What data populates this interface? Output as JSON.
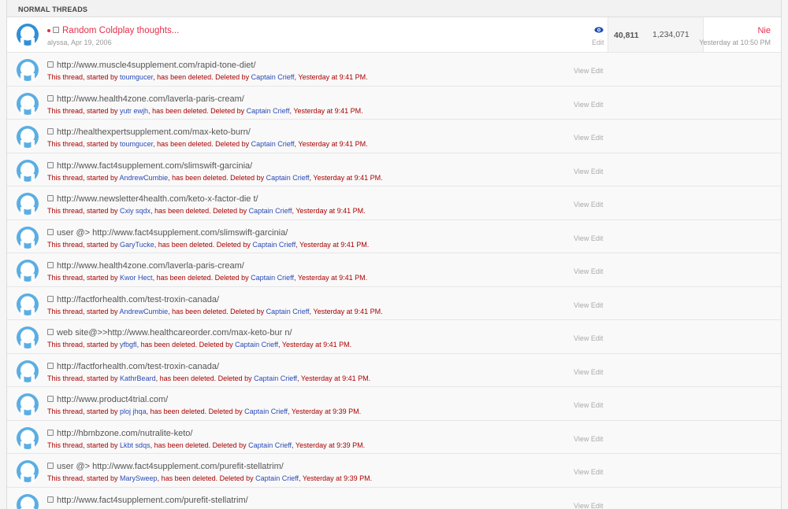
{
  "section": {
    "title": "NORMAL THREADS"
  },
  "sticky": {
    "title": "Random Coldplay thoughts...",
    "author": "alyssa",
    "date": "Apr 19, 2006",
    "edit": "Edit",
    "replies": "40,811",
    "views": "1,234,071",
    "last_user": "Nie",
    "last_time": "Yesterday at 10:50 PM"
  },
  "deleted_text": {
    "prefix": "This thread, started by ",
    "middle": ", has been deleted. Deleted by ",
    "comma": ", ",
    "view_edit": "View Edit"
  },
  "threads": [
    {
      "title": "http://www.muscle4supplement.com/rapid-tone-diet/",
      "starter": "toumgucer",
      "deleter": "Captain Crieff",
      "time": "Yesterday at 9:41 PM."
    },
    {
      "title": "http://www.health4zone.com/laverla-paris-cream/",
      "starter": "yutr ewjh",
      "deleter": "Captain Crieff",
      "time": "Yesterday at 9:41 PM."
    },
    {
      "title": "http://healthexpertsupplement.com/max-keto-burn/",
      "starter": "toumgucer",
      "deleter": "Captain Crieff",
      "time": "Yesterday at 9:41 PM."
    },
    {
      "title": "http://www.fact4supplement.com/slimswift-garcinia/",
      "starter": "AndrewCumbie",
      "deleter": "Captain Crieff",
      "time": "Yesterday at 9:41 PM."
    },
    {
      "title": "http://www.newsletter4health.com/keto-x-factor-die t/",
      "starter": "Cxiy sqdx",
      "deleter": "Captain Crieff",
      "time": "Yesterday at 9:41 PM."
    },
    {
      "title": "user @> http://www.fact4supplement.com/slimswift-garcinia/",
      "starter": "GaryTucke",
      "deleter": "Captain Crieff",
      "time": "Yesterday at 9:41 PM."
    },
    {
      "title": "http://www.health4zone.com/laverla-paris-cream/",
      "starter": "Kwor Hect",
      "deleter": "Captain Crieff",
      "time": "Yesterday at 9:41 PM."
    },
    {
      "title": "http://factforhealth.com/test-troxin-canada/",
      "starter": "AndrewCumbie",
      "deleter": "Captain Crieff",
      "time": "Yesterday at 9:41 PM."
    },
    {
      "title": "web site@>>http://www.healthcareorder.com/max-keto-bur n/",
      "starter": "yfbgfl",
      "deleter": "Captain Crieff",
      "time": "Yesterday at 9:41 PM."
    },
    {
      "title": "http://factforhealth.com/test-troxin-canada/",
      "starter": "KathrBeard",
      "deleter": "Captain Crieff",
      "time": "Yesterday at 9:41 PM."
    },
    {
      "title": "http://www.product4trial.com/",
      "starter": "ploj jhqa",
      "deleter": "Captain Crieff",
      "time": "Yesterday at 9:39 PM."
    },
    {
      "title": "http://hbmbzone.com/nutralite-keto/",
      "starter": "Lkbt sdqs",
      "deleter": "Captain Crieff",
      "time": "Yesterday at 9:39 PM."
    },
    {
      "title": "user @> http://www.fact4supplement.com/purefit-stellatrim/",
      "starter": "MarySweep",
      "deleter": "Captain Crieff",
      "time": "Yesterday at 9:39 PM."
    },
    {
      "title": "http://www.fact4supplement.com/purefit-stellatrim/",
      "starter": "",
      "deleter": "",
      "time": ""
    }
  ],
  "icons": {
    "avatar": "default-avatar-icon",
    "watch": "eye-icon",
    "checkbox": "checkbox-icon"
  },
  "colors": {
    "accent": "#e52f4b",
    "deleted_text": "#aa0000",
    "user_link": "#2b4bb5",
    "avatar_blue": "#5aaee3"
  }
}
